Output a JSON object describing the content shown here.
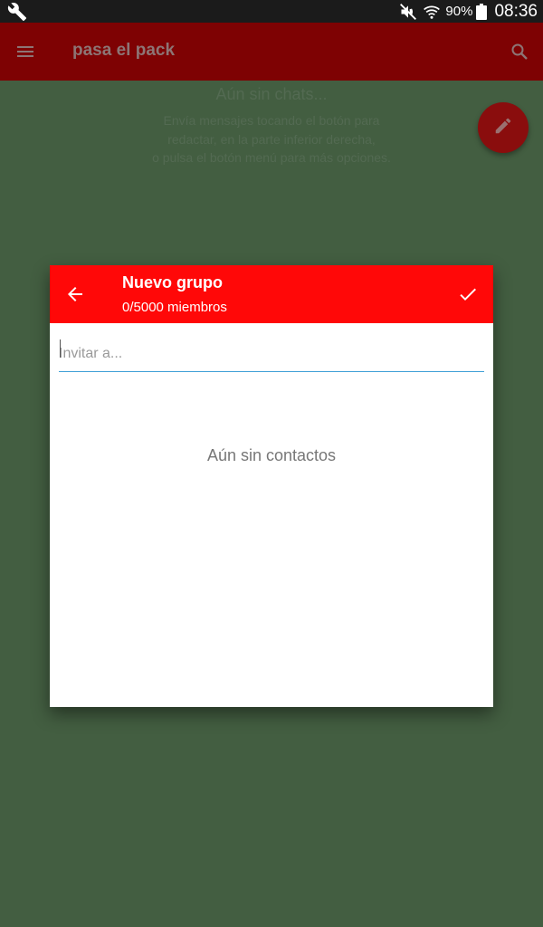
{
  "status_bar": {
    "battery_level": "90%",
    "clock": "08:36"
  },
  "app_bar": {
    "title": "pasa el pack"
  },
  "empty_state": {
    "title": "Aún sin chats...",
    "line1": "Envía mensajes tocando el botón para",
    "line2": "redactar, en la parte inferior derecha,",
    "line3": "o pulsa el botón menú para más opciones."
  },
  "dialog": {
    "title": "Nuevo grupo",
    "subtitle": "0/5000 miembros",
    "invite_placeholder": "Invitar a...",
    "invite_value": "",
    "no_contacts": "Aún sin contactos"
  },
  "colors": {
    "status_bar": "#1b1b1b",
    "app_bar_dimmed": "#7e0203",
    "background_dimmed": "#435e41",
    "dialog_header": "#ff0808",
    "fab_dimmed": "#8a0d0d",
    "input_underline": "#3f9fd6"
  },
  "icons": {
    "status_left": "wrench-icon",
    "mute": "muted-speaker-icon",
    "wifi": "wifi-icon",
    "battery": "battery-icon",
    "menu": "hamburger-menu-icon",
    "search": "search-icon",
    "fab": "pencil-icon",
    "back": "arrow-left-icon",
    "confirm": "checkmark-icon"
  }
}
